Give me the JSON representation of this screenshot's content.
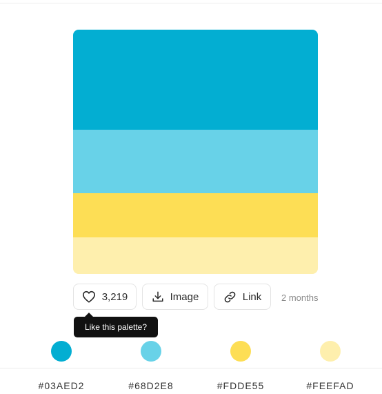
{
  "palette": {
    "colors": [
      {
        "hex": "#03AED2",
        "label": "#03AED2"
      },
      {
        "hex": "#68D2E8",
        "label": "#68D2E8"
      },
      {
        "hex": "#FDDE55",
        "label": "#FDDE55"
      },
      {
        "hex": "#FEEFAD",
        "label": "#FEEFAD"
      }
    ]
  },
  "actions": {
    "like_count": "3,219",
    "image_label": "Image",
    "link_label": "Link",
    "age": "2 months"
  },
  "tooltip": {
    "text": "Like this palette?"
  },
  "icons": {
    "like": "heart-icon",
    "image": "download-icon",
    "link": "link-icon"
  }
}
